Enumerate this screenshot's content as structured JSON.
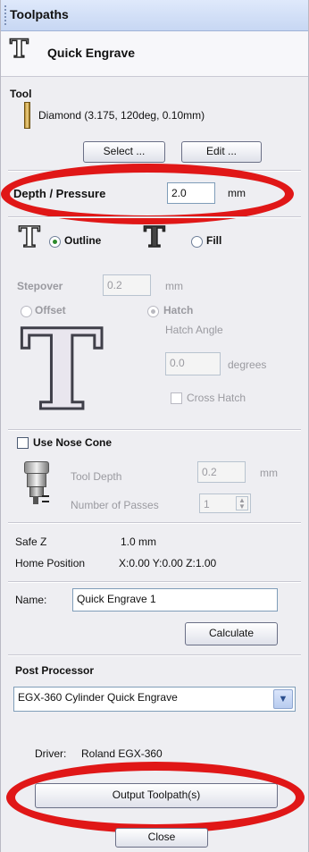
{
  "panel": {
    "title": "Toolpaths",
    "header": "Quick Engrave"
  },
  "tool": {
    "section_label": "Tool",
    "name": "Diamond (3.175, 120deg, 0.10mm)",
    "select_button": "Select ...",
    "edit_button": "Edit ..."
  },
  "depth": {
    "label": "Depth / Pressure",
    "value": "2.0",
    "unit": "mm"
  },
  "mode": {
    "outline_label": "Outline",
    "fill_label": "Fill",
    "selected": "outline"
  },
  "fill_options": {
    "stepover_label": "Stepover",
    "stepover_value": "0.2",
    "stepover_unit": "mm",
    "offset_label": "Offset",
    "hatch_label": "Hatch",
    "hatch_angle_label": "Hatch Angle",
    "hatch_angle_value": "0.0",
    "hatch_angle_unit": "degrees",
    "cross_hatch_label": "Cross Hatch",
    "preview_letter": "T"
  },
  "nose_cone": {
    "label": "Use Nose Cone",
    "tool_depth_label": "Tool Depth",
    "tool_depth_value": "0.2",
    "tool_depth_unit": "mm",
    "passes_label": "Number of Passes",
    "passes_value": "1"
  },
  "positions": {
    "safe_z_label": "Safe Z",
    "safe_z_value": "1.0 mm",
    "home_label": "Home Position",
    "home_value": "X:0.00 Y:0.00 Z:1.00"
  },
  "naming": {
    "name_label": "Name:",
    "name_value": "Quick Engrave 1",
    "calculate_button": "Calculate"
  },
  "post": {
    "label": "Post Processor",
    "selected": "EGX-360 Cylinder Quick Engrave",
    "driver_label": "Driver:",
    "driver_value": "Roland EGX-360"
  },
  "footer": {
    "output_button": "Output Toolpath(s)",
    "close_button": "Close"
  },
  "annotation": {
    "color": "#e01717"
  },
  "icons": {
    "header_icon": "engrave-T-icon",
    "tool_icon": "diamond-bit-icon",
    "outline_icon": "outline-T-icon",
    "fill_icon": "fill-T-icon",
    "nose_cone_icon": "nose-cone-icon",
    "dropdown_icon": "chevron-down-icon"
  }
}
